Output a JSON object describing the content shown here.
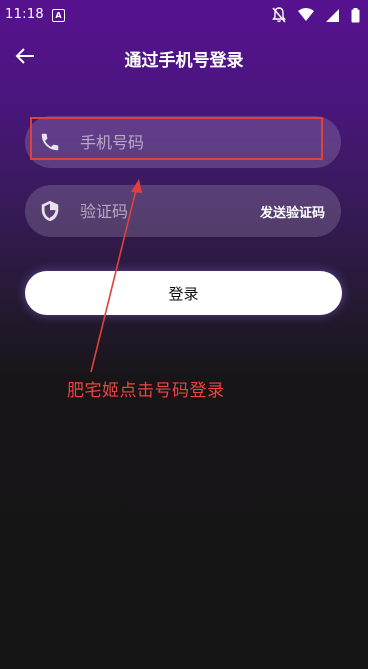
{
  "status_bar": {
    "time": "11:18",
    "notification_icon_letter": "A",
    "icons": [
      "notifications-off-icon",
      "wifi-icon",
      "signal-icon",
      "battery-icon"
    ]
  },
  "header": {
    "title": "通过手机号登录",
    "back_icon": "arrow-left-icon"
  },
  "form": {
    "phone": {
      "icon": "phone-icon",
      "placeholder": "手机号码",
      "value": ""
    },
    "code": {
      "icon": "shield-icon",
      "placeholder": "验证码",
      "value": "",
      "send_label": "发送验证码"
    },
    "login_label": "登录"
  },
  "annotation": {
    "text": "肥宅姬点击号码登录",
    "color": "#e94540"
  },
  "colors": {
    "gradient_top": "#57128f",
    "background_bottom": "#161516",
    "accent_red": "#e0403a"
  }
}
